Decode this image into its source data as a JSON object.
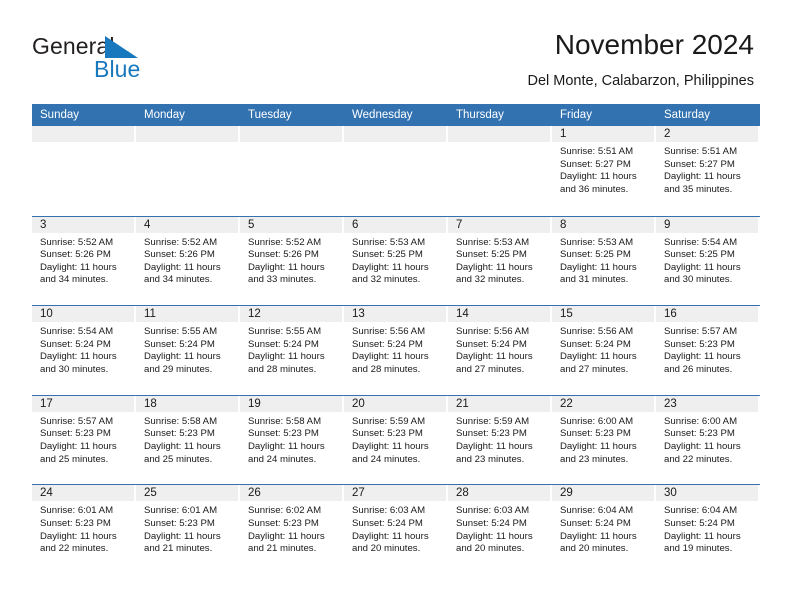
{
  "brand": {
    "name_part1": "General",
    "name_part2": "Blue",
    "triangle_color": "#1878be",
    "text_color": "#231f20"
  },
  "header": {
    "title": "November 2024",
    "subtitle": "Del Monte, Calabarzon, Philippines"
  },
  "theme": {
    "header_blue": "#3272b0",
    "band_gray": "#efefef",
    "text": "#1a1a1a"
  },
  "weekdays": [
    "Sunday",
    "Monday",
    "Tuesday",
    "Wednesday",
    "Thursday",
    "Friday",
    "Saturday"
  ],
  "labels": {
    "sunrise_prefix": "Sunrise:",
    "sunset_prefix": "Sunset:",
    "daylight_prefix": "Daylight:"
  },
  "weeks": [
    [
      {
        "day": "",
        "empty": true,
        "sunrise": "",
        "sunset": "",
        "daylight": ""
      },
      {
        "day": "",
        "empty": true,
        "sunrise": "",
        "sunset": "",
        "daylight": ""
      },
      {
        "day": "",
        "empty": true,
        "sunrise": "",
        "sunset": "",
        "daylight": ""
      },
      {
        "day": "",
        "empty": true,
        "sunrise": "",
        "sunset": "",
        "daylight": ""
      },
      {
        "day": "",
        "empty": true,
        "sunrise": "",
        "sunset": "",
        "daylight": ""
      },
      {
        "day": "1",
        "empty": false,
        "sunrise": "Sunrise: 5:51 AM",
        "sunset": "Sunset: 5:27 PM",
        "daylight": "Daylight: 11 hours and 36 minutes."
      },
      {
        "day": "2",
        "empty": false,
        "sunrise": "Sunrise: 5:51 AM",
        "sunset": "Sunset: 5:27 PM",
        "daylight": "Daylight: 11 hours and 35 minutes."
      }
    ],
    [
      {
        "day": "3",
        "empty": false,
        "sunrise": "Sunrise: 5:52 AM",
        "sunset": "Sunset: 5:26 PM",
        "daylight": "Daylight: 11 hours and 34 minutes."
      },
      {
        "day": "4",
        "empty": false,
        "sunrise": "Sunrise: 5:52 AM",
        "sunset": "Sunset: 5:26 PM",
        "daylight": "Daylight: 11 hours and 34 minutes."
      },
      {
        "day": "5",
        "empty": false,
        "sunrise": "Sunrise: 5:52 AM",
        "sunset": "Sunset: 5:26 PM",
        "daylight": "Daylight: 11 hours and 33 minutes."
      },
      {
        "day": "6",
        "empty": false,
        "sunrise": "Sunrise: 5:53 AM",
        "sunset": "Sunset: 5:25 PM",
        "daylight": "Daylight: 11 hours and 32 minutes."
      },
      {
        "day": "7",
        "empty": false,
        "sunrise": "Sunrise: 5:53 AM",
        "sunset": "Sunset: 5:25 PM",
        "daylight": "Daylight: 11 hours and 32 minutes."
      },
      {
        "day": "8",
        "empty": false,
        "sunrise": "Sunrise: 5:53 AM",
        "sunset": "Sunset: 5:25 PM",
        "daylight": "Daylight: 11 hours and 31 minutes."
      },
      {
        "day": "9",
        "empty": false,
        "sunrise": "Sunrise: 5:54 AM",
        "sunset": "Sunset: 5:25 PM",
        "daylight": "Daylight: 11 hours and 30 minutes."
      }
    ],
    [
      {
        "day": "10",
        "empty": false,
        "sunrise": "Sunrise: 5:54 AM",
        "sunset": "Sunset: 5:24 PM",
        "daylight": "Daylight: 11 hours and 30 minutes."
      },
      {
        "day": "11",
        "empty": false,
        "sunrise": "Sunrise: 5:55 AM",
        "sunset": "Sunset: 5:24 PM",
        "daylight": "Daylight: 11 hours and 29 minutes."
      },
      {
        "day": "12",
        "empty": false,
        "sunrise": "Sunrise: 5:55 AM",
        "sunset": "Sunset: 5:24 PM",
        "daylight": "Daylight: 11 hours and 28 minutes."
      },
      {
        "day": "13",
        "empty": false,
        "sunrise": "Sunrise: 5:56 AM",
        "sunset": "Sunset: 5:24 PM",
        "daylight": "Daylight: 11 hours and 28 minutes."
      },
      {
        "day": "14",
        "empty": false,
        "sunrise": "Sunrise: 5:56 AM",
        "sunset": "Sunset: 5:24 PM",
        "daylight": "Daylight: 11 hours and 27 minutes."
      },
      {
        "day": "15",
        "empty": false,
        "sunrise": "Sunrise: 5:56 AM",
        "sunset": "Sunset: 5:24 PM",
        "daylight": "Daylight: 11 hours and 27 minutes."
      },
      {
        "day": "16",
        "empty": false,
        "sunrise": "Sunrise: 5:57 AM",
        "sunset": "Sunset: 5:23 PM",
        "daylight": "Daylight: 11 hours and 26 minutes."
      }
    ],
    [
      {
        "day": "17",
        "empty": false,
        "sunrise": "Sunrise: 5:57 AM",
        "sunset": "Sunset: 5:23 PM",
        "daylight": "Daylight: 11 hours and 25 minutes."
      },
      {
        "day": "18",
        "empty": false,
        "sunrise": "Sunrise: 5:58 AM",
        "sunset": "Sunset: 5:23 PM",
        "daylight": "Daylight: 11 hours and 25 minutes."
      },
      {
        "day": "19",
        "empty": false,
        "sunrise": "Sunrise: 5:58 AM",
        "sunset": "Sunset: 5:23 PM",
        "daylight": "Daylight: 11 hours and 24 minutes."
      },
      {
        "day": "20",
        "empty": false,
        "sunrise": "Sunrise: 5:59 AM",
        "sunset": "Sunset: 5:23 PM",
        "daylight": "Daylight: 11 hours and 24 minutes."
      },
      {
        "day": "21",
        "empty": false,
        "sunrise": "Sunrise: 5:59 AM",
        "sunset": "Sunset: 5:23 PM",
        "daylight": "Daylight: 11 hours and 23 minutes."
      },
      {
        "day": "22",
        "empty": false,
        "sunrise": "Sunrise: 6:00 AM",
        "sunset": "Sunset: 5:23 PM",
        "daylight": "Daylight: 11 hours and 23 minutes."
      },
      {
        "day": "23",
        "empty": false,
        "sunrise": "Sunrise: 6:00 AM",
        "sunset": "Sunset: 5:23 PM",
        "daylight": "Daylight: 11 hours and 22 minutes."
      }
    ],
    [
      {
        "day": "24",
        "empty": false,
        "sunrise": "Sunrise: 6:01 AM",
        "sunset": "Sunset: 5:23 PM",
        "daylight": "Daylight: 11 hours and 22 minutes."
      },
      {
        "day": "25",
        "empty": false,
        "sunrise": "Sunrise: 6:01 AM",
        "sunset": "Sunset: 5:23 PM",
        "daylight": "Daylight: 11 hours and 21 minutes."
      },
      {
        "day": "26",
        "empty": false,
        "sunrise": "Sunrise: 6:02 AM",
        "sunset": "Sunset: 5:23 PM",
        "daylight": "Daylight: 11 hours and 21 minutes."
      },
      {
        "day": "27",
        "empty": false,
        "sunrise": "Sunrise: 6:03 AM",
        "sunset": "Sunset: 5:24 PM",
        "daylight": "Daylight: 11 hours and 20 minutes."
      },
      {
        "day": "28",
        "empty": false,
        "sunrise": "Sunrise: 6:03 AM",
        "sunset": "Sunset: 5:24 PM",
        "daylight": "Daylight: 11 hours and 20 minutes."
      },
      {
        "day": "29",
        "empty": false,
        "sunrise": "Sunrise: 6:04 AM",
        "sunset": "Sunset: 5:24 PM",
        "daylight": "Daylight: 11 hours and 20 minutes."
      },
      {
        "day": "30",
        "empty": false,
        "sunrise": "Sunrise: 6:04 AM",
        "sunset": "Sunset: 5:24 PM",
        "daylight": "Daylight: 11 hours and 19 minutes."
      }
    ]
  ]
}
